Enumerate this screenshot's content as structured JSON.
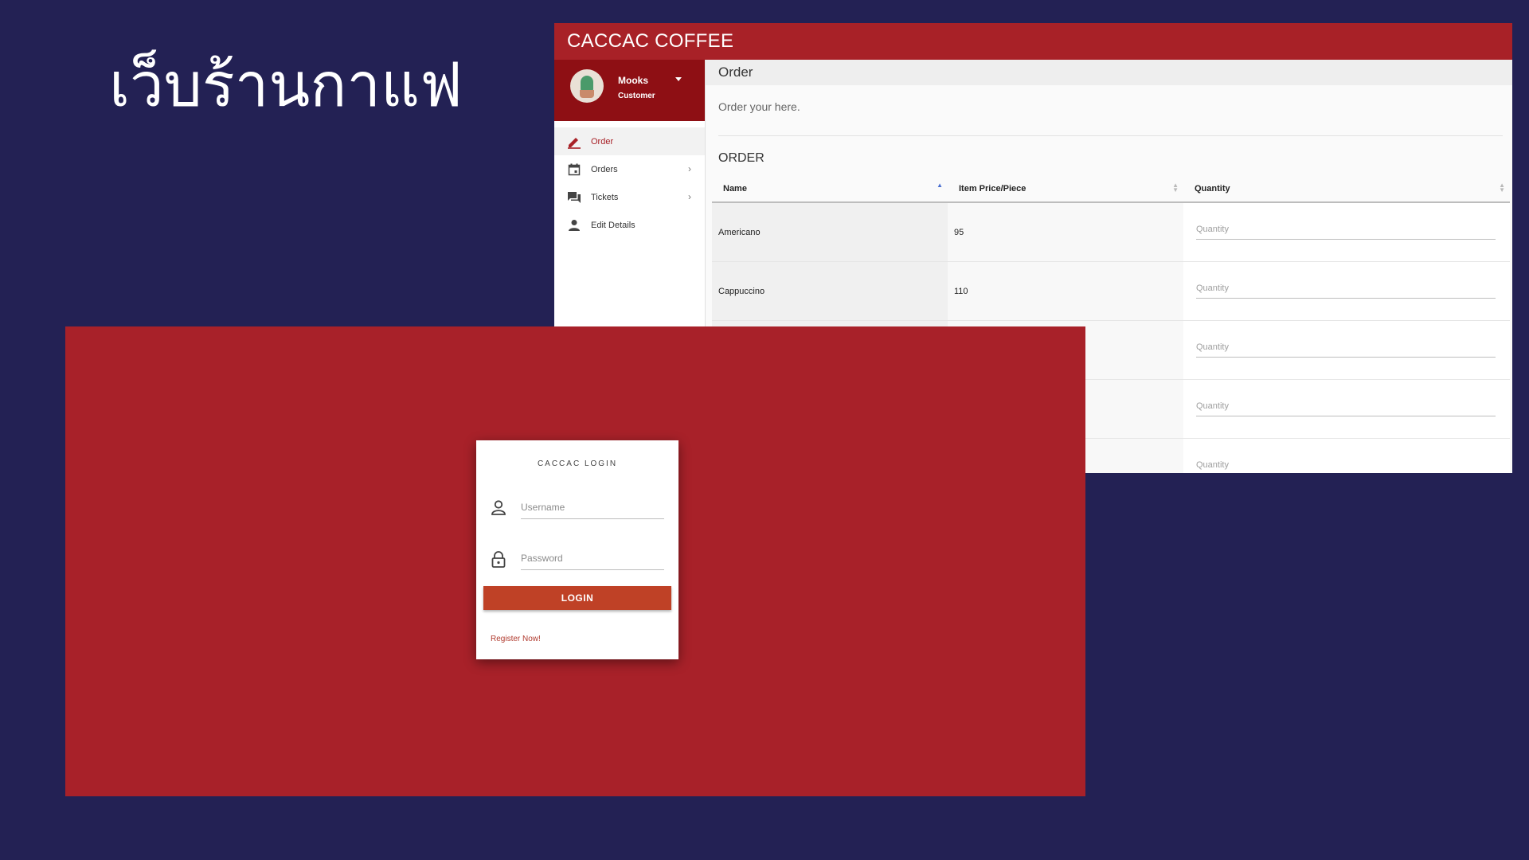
{
  "slide": {
    "title": "เว็บร้านกาแฟ"
  },
  "dashboard": {
    "brand": "CACCAC COFFEE",
    "user": {
      "name": "Mooks",
      "role": "Customer"
    },
    "nav": [
      {
        "label": "Order",
        "icon": "pencil-icon",
        "active": true
      },
      {
        "label": "Orders",
        "icon": "calendar-icon",
        "chevron": true
      },
      {
        "label": "Tickets",
        "icon": "chat-icon",
        "chevron": true
      },
      {
        "label": "Edit Details",
        "icon": "person-icon"
      }
    ],
    "page": {
      "title": "Order",
      "subtitle": "Order your here.",
      "section": "ORDER"
    },
    "table": {
      "headers": [
        "Name",
        "Item Price/Piece",
        "Quantity"
      ],
      "rows": [
        {
          "name": "Americano",
          "price": "95",
          "qty_placeholder": "Quantity"
        },
        {
          "name": "Cappuccino",
          "price": "110",
          "qty_placeholder": "Quantity"
        },
        {
          "name": "",
          "price": "",
          "qty_placeholder": "Quantity"
        },
        {
          "name": "",
          "price": "",
          "qty_placeholder": "Quantity"
        },
        {
          "name": "",
          "price": "",
          "qty_placeholder": "Quantity"
        }
      ]
    }
  },
  "login": {
    "title": "CACCAC LOGIN",
    "username_placeholder": "Username",
    "password_placeholder": "Password",
    "button": "LOGIN",
    "register": "Register Now!"
  },
  "colors": {
    "background": "#232154",
    "brand_red": "#a82127",
    "button": "#bf4126"
  }
}
